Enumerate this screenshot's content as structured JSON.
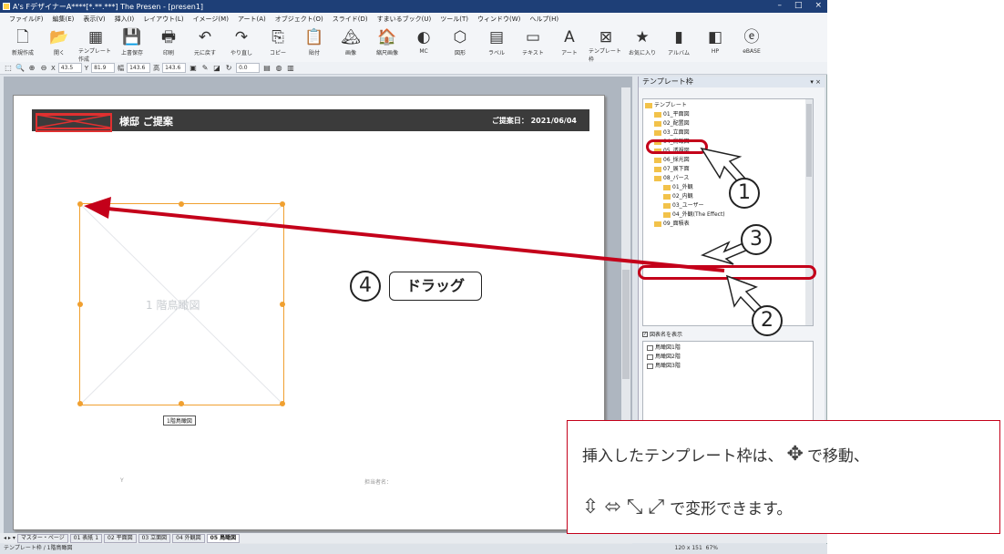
{
  "window": {
    "title": "A's FデザイナーA****[*.**.***] The Presen - [presen1]",
    "controls": [
      "–",
      "□",
      "×"
    ]
  },
  "menu": [
    "ファイル(F)",
    "編集(E)",
    "表示(V)",
    "挿入(I)",
    "レイアウト(L)",
    "イメージ(M)",
    "アート(A)",
    "オブジェクト(O)",
    "スライド(D)",
    "すまいるブック(U)",
    "ツール(T)",
    "ウィンドウ(W)",
    "ヘルプ(H)"
  ],
  "ribbon": [
    {
      "label": "新規作成",
      "icon": "new-doc-icon",
      "glyph": "🗋"
    },
    {
      "label": "開く",
      "icon": "open-folder-icon",
      "glyph": "📂"
    },
    {
      "label": "テンプレート作成",
      "icon": "template-create-icon",
      "glyph": "▦"
    },
    {
      "label": "上書保存",
      "icon": "save-icon",
      "glyph": "💾"
    },
    {
      "label": "印刷",
      "icon": "print-icon",
      "glyph": "🖶"
    },
    {
      "label": "元に戻す",
      "icon": "undo-icon",
      "glyph": "↶"
    },
    {
      "label": "やり直し",
      "icon": "redo-icon",
      "glyph": "↷"
    },
    {
      "label": "コピー",
      "icon": "copy-icon",
      "glyph": "⎘"
    },
    {
      "label": "貼付",
      "icon": "paste-icon",
      "glyph": "📋"
    },
    {
      "label": "画像",
      "icon": "image-icon",
      "glyph": "🏔"
    },
    {
      "label": "縮尺画像",
      "icon": "scaled-image-icon",
      "glyph": "🏠"
    },
    {
      "label": "MC",
      "icon": "mc-icon",
      "glyph": "◐"
    },
    {
      "label": "図形",
      "icon": "shape-icon",
      "glyph": "⬡"
    },
    {
      "label": "ラベル",
      "icon": "label-icon",
      "glyph": "▤"
    },
    {
      "label": "テキスト",
      "icon": "text-icon",
      "glyph": "▭"
    },
    {
      "label": "アート",
      "icon": "art-icon",
      "glyph": "A"
    },
    {
      "label": "テンプレート枠",
      "icon": "template-frame-icon",
      "glyph": "⊠"
    },
    {
      "label": "お気に入り",
      "icon": "favorite-icon",
      "glyph": "★"
    },
    {
      "label": "アルバム",
      "icon": "album-icon",
      "glyph": "▮"
    },
    {
      "label": "HP",
      "icon": "hp-icon",
      "glyph": "◧"
    },
    {
      "label": "eBASE",
      "icon": "ebase-icon",
      "glyph": "ⓔ"
    }
  ],
  "toolbar2": {
    "x_label": "X",
    "x_value": "43.5",
    "y_label": "Y",
    "y_value": "81.9",
    "w_label": "幅",
    "w_value": "143.6",
    "h_label": "高",
    "h_value": "143.6",
    "rot_value": "0.0"
  },
  "document": {
    "proposal_title": "様邸 ご提案",
    "proposal_date": "ご提案日： 2021/06/04",
    "frame_label": "1 階鳥瞰図",
    "frame_caption": "1階鳥瞰図",
    "footer_left": "Y",
    "footer_right": "担当者名："
  },
  "sheet_tabs": [
    "マスター・ページ",
    "01 表紙 1",
    "02 平面図",
    "03 立面図",
    "04 外観図",
    "05 鳥瞰図"
  ],
  "status": {
    "left": "テンプレート枠 / 1階鳥瞰図",
    "size": "120 x 151",
    "zoom": "67%"
  },
  "panel": {
    "title": "テンプレート枠",
    "tree": [
      {
        "label": "テンプレート",
        "level": 0
      },
      {
        "label": "01_平面図",
        "level": 1
      },
      {
        "label": "02_配置図",
        "level": 1
      },
      {
        "label": "03_立面図",
        "level": 1
      },
      {
        "label": "04_鳥瞰図",
        "level": 1
      },
      {
        "label": "05_透視図",
        "level": 1
      },
      {
        "label": "06_採光図",
        "level": 1
      },
      {
        "label": "07_展下面",
        "level": 1
      },
      {
        "label": "08_パース",
        "level": 1
      },
      {
        "label": "01_外観",
        "level": 2
      },
      {
        "label": "02_内観",
        "level": 2
      },
      {
        "label": "03_ユーザー",
        "level": 2
      },
      {
        "label": "04_外観(The Effect)",
        "level": 2
      },
      {
        "label": "09_面積表",
        "level": 1
      }
    ],
    "show_name_label": "図表名を表示",
    "list": [
      "鳥瞰図1階",
      "鳥瞰図2階",
      "鳥瞰図3階"
    ]
  },
  "annotations": {
    "steps": [
      "1",
      "2",
      "3",
      "4"
    ],
    "drag_label": "ドラッグ",
    "note_line1_a": "挿入したテンプレート枠は、",
    "note_line1_b": "で移動、",
    "note_line2": "で変形できます。",
    "move_cursor_icon": "move-cursor-icon",
    "resize_cursor_icons": [
      "resize-vertical-icon",
      "resize-horizontal-icon",
      "resize-diagonal-nwse-icon",
      "resize-diagonal-nesw-icon"
    ]
  },
  "colors": {
    "title_bar": "#1e3f77",
    "annotation_red": "#c4001a",
    "frame_orange": "#f0a030",
    "header_band": "#3b3b3b"
  }
}
